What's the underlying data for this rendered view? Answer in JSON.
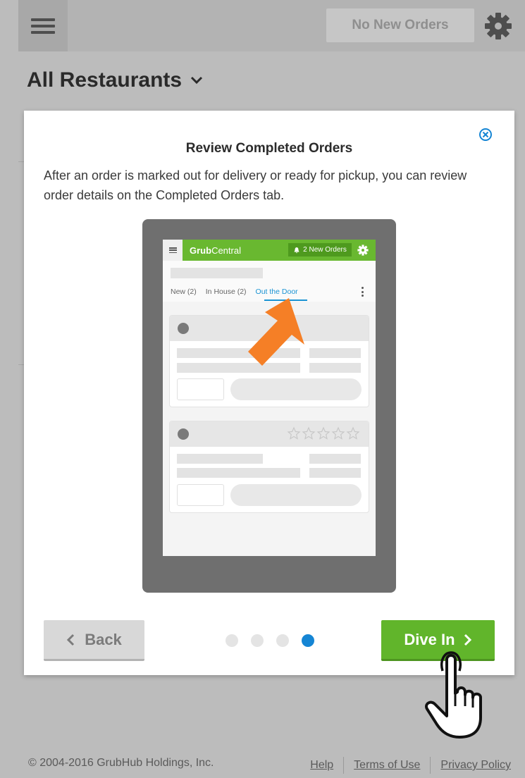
{
  "header": {
    "orders_status": "No New Orders",
    "menu_icon": "hamburger-icon",
    "settings_icon": "gear-icon"
  },
  "restaurant": {
    "selected": "All Restaurants"
  },
  "modal": {
    "title": "Review Completed Orders",
    "body": "After an order is marked out for delivery or ready for pickup, you can review order details on the Completed Orders tab.",
    "back_label": "Back",
    "next_label": "Dive In",
    "page_count": 4,
    "current_page": 4
  },
  "illustration": {
    "brand_bold": "Grub",
    "brand_light": "Central",
    "orders_badge": "2 New Orders",
    "tabs": [
      "New (2)",
      "In House (2)",
      "Out the Door"
    ],
    "active_tab": "Out the Door"
  },
  "footer": {
    "copyright": "© 2004-2016 GrubHub Holdings, Inc.",
    "links": [
      "Help",
      "Terms of Use",
      "Privacy Policy"
    ]
  },
  "colors": {
    "brand_green": "#61b52b",
    "active_blue": "#1585d4",
    "arrow_orange": "#f57f26"
  }
}
